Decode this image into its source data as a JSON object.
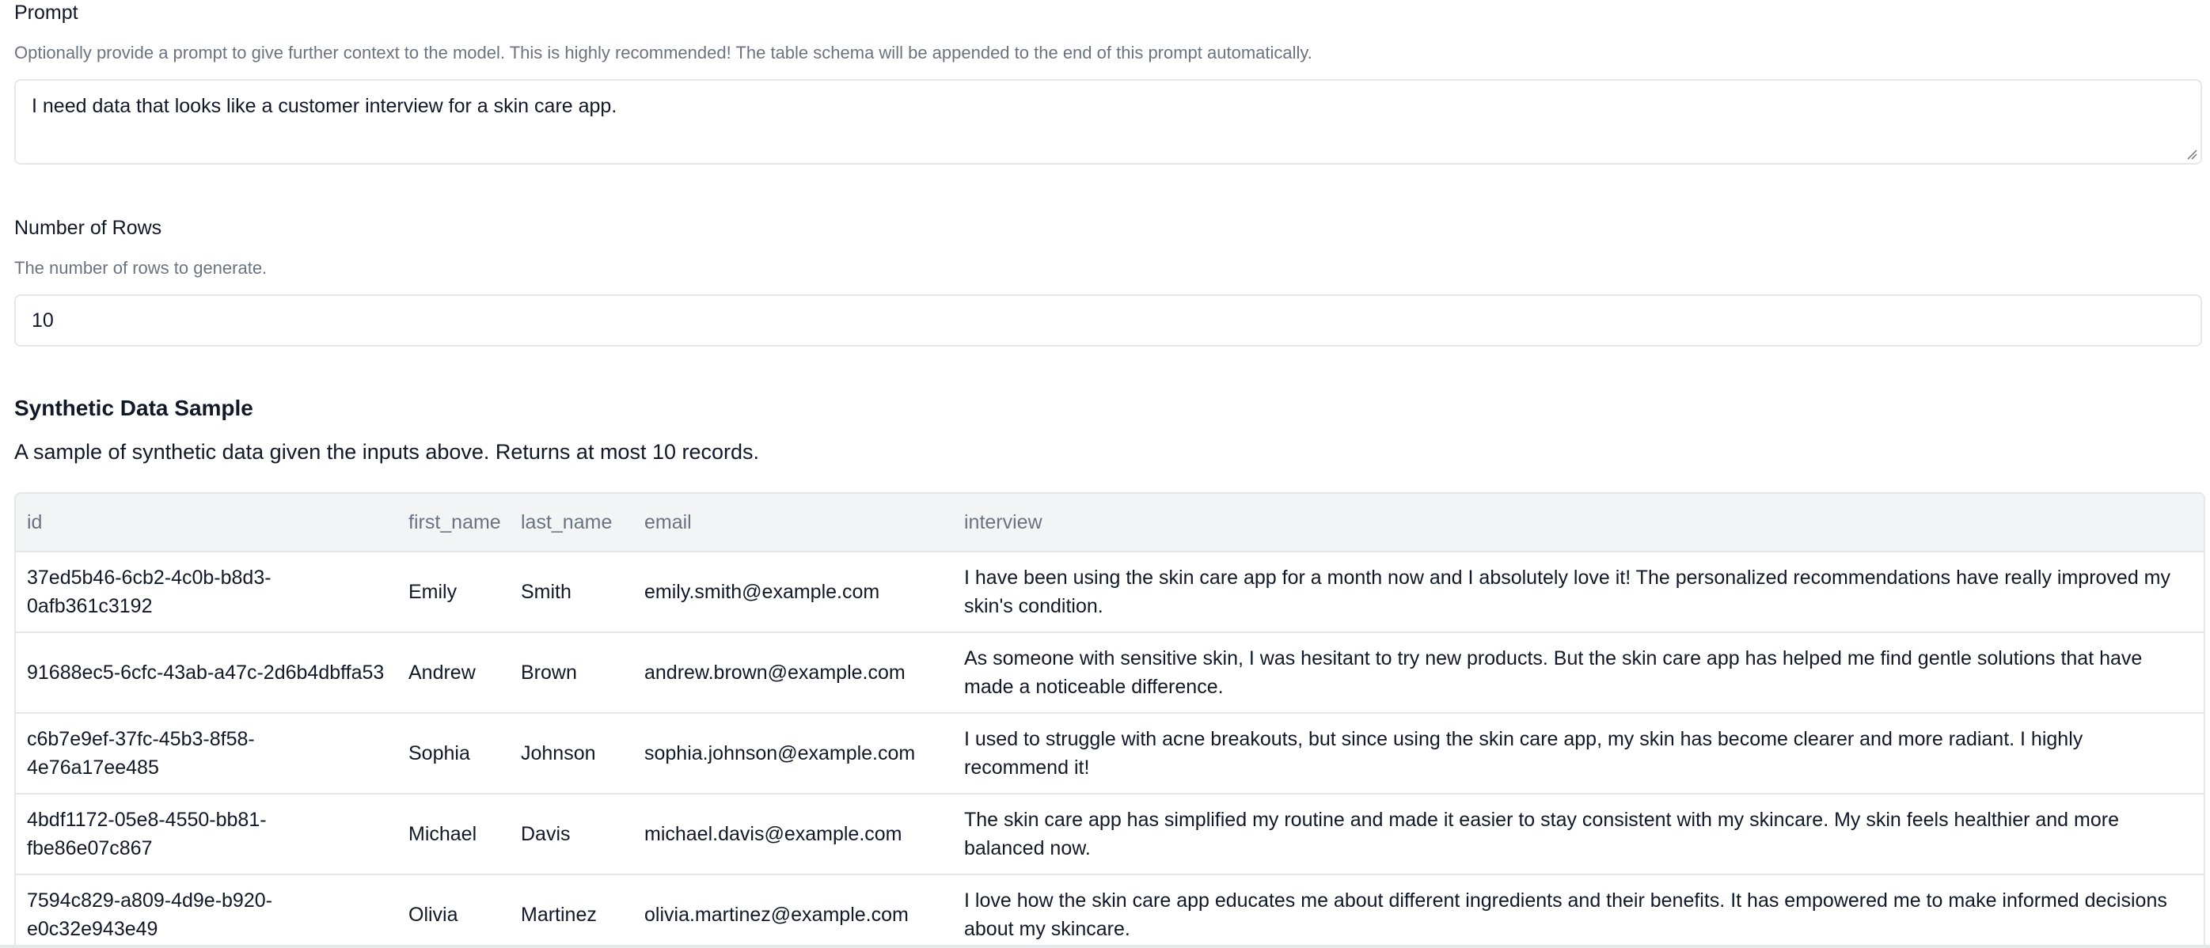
{
  "prompt": {
    "label": "Prompt",
    "help": "Optionally provide a prompt to give further context to the model. This is highly recommended! The table schema will be appended to the end of this prompt automatically.",
    "value": "I need data that looks like a customer interview for a skin care app."
  },
  "rows": {
    "label": "Number of Rows",
    "help": "The number of rows to generate.",
    "value": "10"
  },
  "sample": {
    "title": "Synthetic Data Sample",
    "description": "A sample of synthetic data given the inputs above. Returns at most 10 records.",
    "columns": [
      "id",
      "first_name",
      "last_name",
      "email",
      "interview"
    ],
    "records": [
      {
        "id": "37ed5b46-6cb2-4c0b-b8d3-0afb361c3192",
        "first_name": "Emily",
        "last_name": "Smith",
        "email": "emily.smith@example.com",
        "interview": "I have been using the skin care app for a month now and I absolutely love it! The personalized recommendations have really improved my skin's condition."
      },
      {
        "id": "91688ec5-6cfc-43ab-a47c-2d6b4dbffa53",
        "first_name": "Andrew",
        "last_name": "Brown",
        "email": "andrew.brown@example.com",
        "interview": "As someone with sensitive skin, I was hesitant to try new products. But the skin care app has helped me find gentle solutions that have made a noticeable difference."
      },
      {
        "id": "c6b7e9ef-37fc-45b3-8f58-4e76a17ee485",
        "first_name": "Sophia",
        "last_name": "Johnson",
        "email": "sophia.johnson@example.com",
        "interview": "I used to struggle with acne breakouts, but since using the skin care app, my skin has become clearer and more radiant. I highly recommend it!"
      },
      {
        "id": "4bdf1172-05e8-4550-bb81-fbe86e07c867",
        "first_name": "Michael",
        "last_name": "Davis",
        "email": "michael.davis@example.com",
        "interview": "The skin care app has simplified my routine and made it easier to stay consistent with my skincare. My skin feels healthier and more balanced now."
      },
      {
        "id": "7594c829-a809-4d9e-b920-e0c32e943e49",
        "first_name": "Olivia",
        "last_name": "Martinez",
        "email": "olivia.martinez@example.com",
        "interview": "I love how the skin care app educates me about different ingredients and their benefits. It has empowered me to make informed decisions about my skincare."
      }
    ]
  }
}
